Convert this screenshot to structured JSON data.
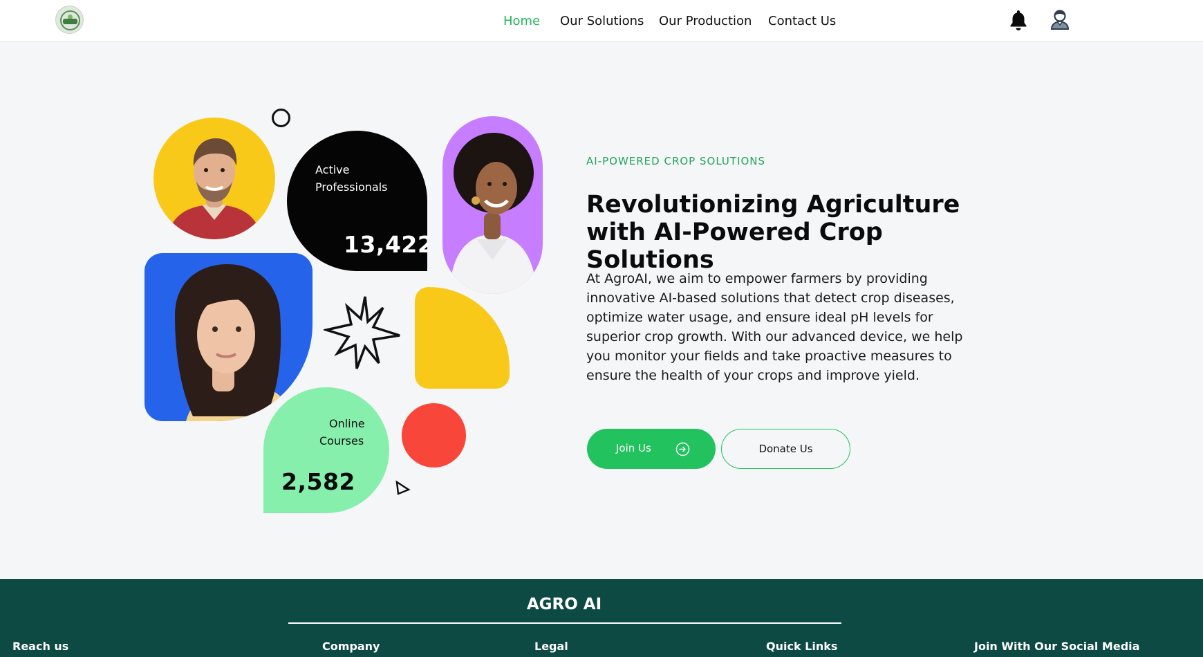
{
  "header": {
    "logo_alt": "Agro AI logo",
    "nav": [
      {
        "label": "Home",
        "active": true
      },
      {
        "label": "Our Solutions",
        "active": false
      },
      {
        "label": "Our Production",
        "active": false
      },
      {
        "label": "Contact Us",
        "active": false
      }
    ],
    "icons": {
      "notifications": "bell-icon",
      "profile": "user-icon"
    }
  },
  "hero": {
    "eyebrow": "AI-POWERED CROP SOLUTIONS",
    "headline": "Revolutionizing Agriculture with AI-Powered Crop Solutions",
    "description": "At AgroAI, we aim to empower farmers by providing innovative AI-based solutions that detect crop diseases, optimize water usage, and ensure ideal pH levels for superior crop growth. With our advanced device, we help you monitor your fields and take proactive measures to ensure the health of your crops and improve yield.",
    "stats": {
      "professionals": {
        "label_line1": "Active",
        "label_line2": "Professionals",
        "value": "13,422"
      },
      "courses": {
        "label_line1": "Online",
        "label_line2": "Courses",
        "value": "2,582"
      }
    },
    "buttons": {
      "join": "Join Us",
      "donate": "Donate Us"
    },
    "colors": {
      "accent": "#22c35e",
      "yellow": "#f8c918",
      "blue": "#2563eb",
      "purple": "#c77dff",
      "mint": "#86efac",
      "red": "#f8463a"
    }
  },
  "footer": {
    "brand": "AGRO AI",
    "columns": [
      "Reach us",
      "Company",
      "Legal",
      "Quick Links",
      "Join With Our Social Media"
    ],
    "background": "#0d4a43"
  }
}
